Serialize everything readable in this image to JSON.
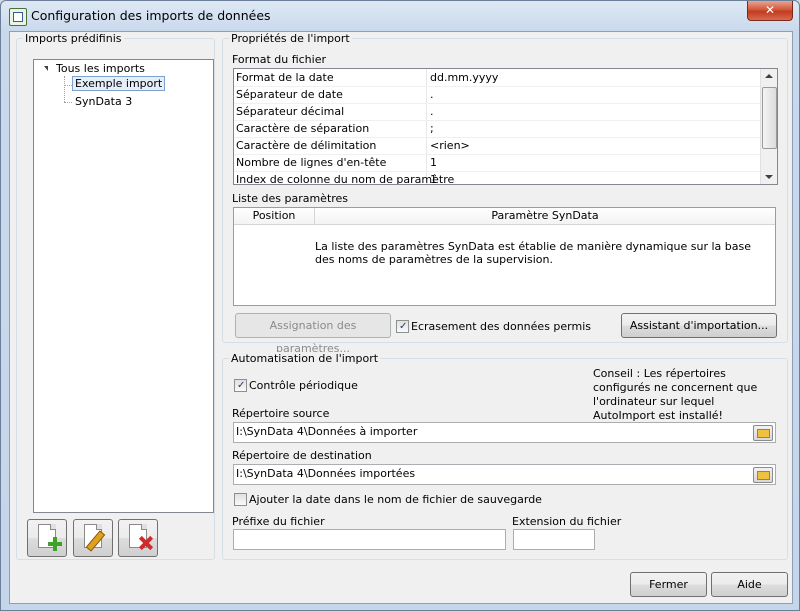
{
  "window": {
    "title": "Configuration des imports de données",
    "close_label": "✕"
  },
  "left_panel": {
    "group_label": "Imports prédifinis",
    "tree": [
      {
        "label": "Tous les imports"
      },
      {
        "label": "Exemple import",
        "selected": true
      },
      {
        "label": "SynData 3"
      }
    ],
    "toolbar_icons": [
      "new-document-icon",
      "edit-document-icon",
      "delete-document-icon"
    ]
  },
  "properties": {
    "group_label": "Propriétés de l'import",
    "format_label": "Format du fichier",
    "rows": [
      {
        "name": "Format de la date",
        "value": "dd.mm.yyyy"
      },
      {
        "name": "Séparateur de date",
        "value": "."
      },
      {
        "name": "Séparateur décimal",
        "value": "."
      },
      {
        "name": "Caractère de séparation",
        "value": ";"
      },
      {
        "name": "Caractère de délimitation",
        "value": "<rien>"
      },
      {
        "name": "Nombre de lignes d'en-tête",
        "value": "1"
      },
      {
        "name": "Index de colonne du nom de paramètre",
        "value": "1"
      }
    ],
    "params_label": "Liste des paramètres",
    "columns": [
      "Position",
      "Paramètre SynData"
    ],
    "params_message": "La liste des paramètres SynData est établie de manière dynamique sur la base des noms de paramètres de la supervision.",
    "assign_button": "Assignation des paramètres...",
    "overwrite_label": "Ecrasement des données permis",
    "overwrite_checked": true,
    "assistant_button": "Assistant d'importation..."
  },
  "automation": {
    "group_label": "Automatisation de l'import",
    "periodic_label": "Contrôle périodique",
    "periodic_checked": true,
    "hint": "Conseil : Les répertoires configurés ne concernent que l'ordinateur sur lequel AutoImport est installé!",
    "source_label": "Répertoire source",
    "source_value": "I:\\SynData 4\\Données à importer",
    "dest_label": "Répertoire de destination",
    "dest_value": "I:\\SynData 4\\Données importées",
    "adddate_label": "Ajouter la date dans le nom de fichier de sauvegarde",
    "adddate_checked": false,
    "prefix_label": "Préfixe du fichier",
    "prefix_value": "",
    "ext_label": "Extension du fichier",
    "ext_value": ""
  },
  "footer": {
    "close_button": "Fermer",
    "help_button": "Aide"
  }
}
